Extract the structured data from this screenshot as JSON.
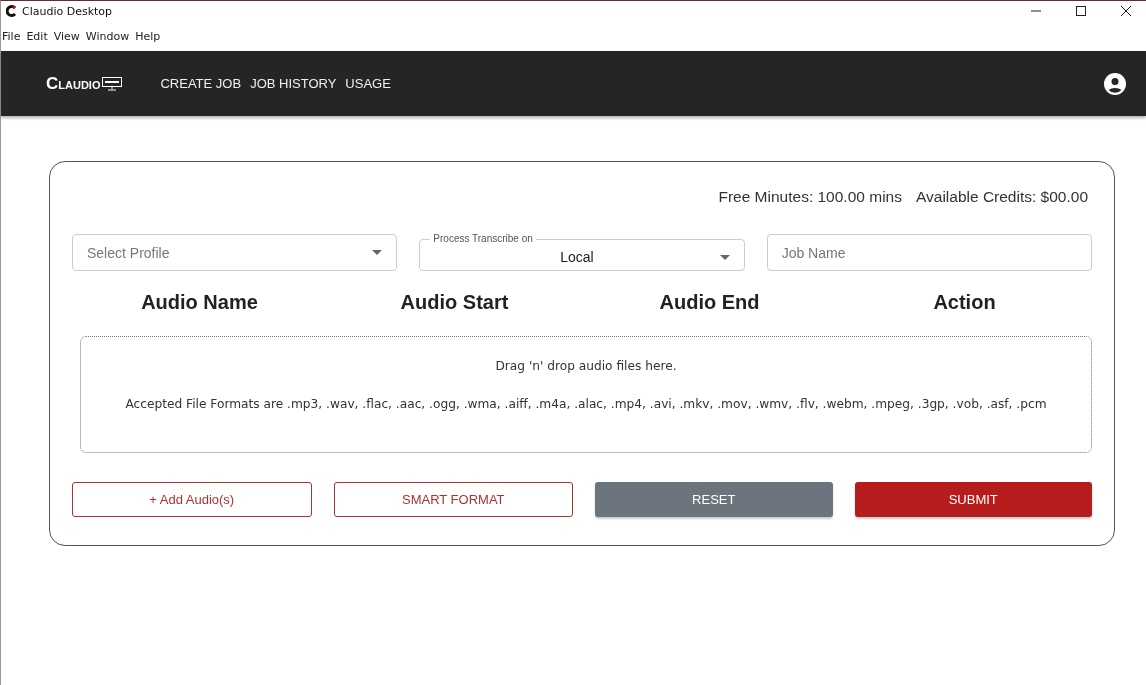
{
  "window": {
    "title": "Claudio Desktop"
  },
  "menu": [
    "File",
    "Edit",
    "View",
    "Window",
    "Help"
  ],
  "nav": {
    "logo": "CLAUDIO",
    "links": [
      "CREATE JOB",
      "JOB HISTORY",
      "USAGE"
    ]
  },
  "stats": [
    "Free Minutes: 100.00 mins",
    "Available Credits: $00.00"
  ],
  "fields": [
    {
      "kind": "select",
      "placeholder": "Select Profile"
    },
    {
      "kind": "select",
      "label": "Process Transcribe on",
      "value": "Local"
    },
    {
      "kind": "text",
      "placeholder": "Job Name"
    }
  ],
  "columns": [
    "Audio Name",
    "Audio Start",
    "Audio End",
    "Action"
  ],
  "dropzone": {
    "title": "Drag 'n' drop audio files here.",
    "formats": "Accepted File Formats are .mp3, .wav, .flac, .aac, .ogg, .wma, .aiff, .m4a, .alac, .mp4, .avi, .mkv, .mov, .wmv, .flv, .webm, .mpeg, .3gp, .vob, .asf, .pcm"
  },
  "buttons": [
    {
      "kind": "outline",
      "label": "+ Add Audio(s)"
    },
    {
      "kind": "outline",
      "label": "SMART FORMAT"
    },
    {
      "kind": "grey",
      "label": "RESET"
    },
    {
      "kind": "primary",
      "label": "SUBMIT"
    }
  ]
}
